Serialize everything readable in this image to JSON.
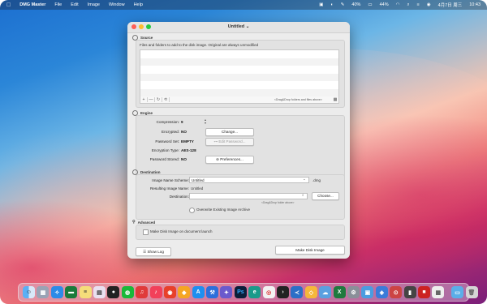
{
  "menubar": {
    "app_name": "DMG Master",
    "items": [
      "File",
      "Edit",
      "Image",
      "Window",
      "Help"
    ],
    "battery": "40%",
    "status": "44%",
    "date": "4月7日 周三",
    "time": "10:43"
  },
  "window": {
    "title": "Untitled",
    "source": {
      "heading": "Source",
      "description": "Files and folders to add to the disk image. Original are always unmodified",
      "toolbar_buttons": [
        "+",
        "—",
        "↻",
        "⟲"
      ],
      "drop_hint": "<Drag&Drop folders and files above>"
    },
    "engine": {
      "heading": "Engine",
      "compression_label": "Compression:",
      "compression_value": "9",
      "encrypted_label": "Encrypted:",
      "encrypted_value": "NO",
      "change_button": "Change...",
      "password_set_label": "Password Set:",
      "password_set_value": "EMPTY",
      "edit_password_button": "Edit Password...",
      "encryption_type_label": "Encryption Type:",
      "encryption_type_value": "AES-128",
      "password_stored_label": "Password Stored:",
      "password_stored_value": "NO",
      "preferences_button": "Preferences..."
    },
    "destination": {
      "heading": "Destination",
      "image_name_scheme_label": "Image Name Scheme:",
      "image_name_scheme_value": "Untitled",
      "extension": ".dmg",
      "resulting_name_label": "Resulting Image Name:",
      "resulting_name_value": "Untitled",
      "destination_label": "Destination:",
      "destination_value": "",
      "choose_button": "Choose...",
      "drop_hint": "<Drag&Drop folder above>",
      "overwrite_label": "Overwrite Existing Image Archive"
    },
    "advanced": {
      "heading": "Advanced",
      "make_on_launch_label": "Make Disk Image on document launch"
    },
    "show_log_button": "Show Log",
    "make_disk_image_button": "Make Disk Image"
  },
  "dock": {
    "icons": [
      "finder-icon",
      "launchpad-icon",
      "safari-icon",
      "terminal-icon",
      "notes-icon",
      "gallery-icon",
      "qq-icon",
      "wechat-icon",
      "netease-music-icon",
      "music-icon",
      "weibo-icon",
      "sketch-icon",
      "app-store-icon",
      "xcode-icon",
      "instruments-icon",
      "photoshop-icon",
      "edge-icon",
      "chrome-icon",
      "terminal-dark-icon",
      "vscode-icon",
      "sketch2-icon",
      "finder2-icon",
      "excel-icon",
      "system-prefs-icon",
      "preview-icon",
      "dmg-master-icon",
      "disk-utility-icon",
      "activity-icon",
      "photo-booth-icon",
      "calendar-icon",
      "folder-icon",
      "trash-icon"
    ]
  },
  "colors": {
    "close": "#ff5f57",
    "minimize": "#febc2e",
    "zoom": "#28c840"
  }
}
